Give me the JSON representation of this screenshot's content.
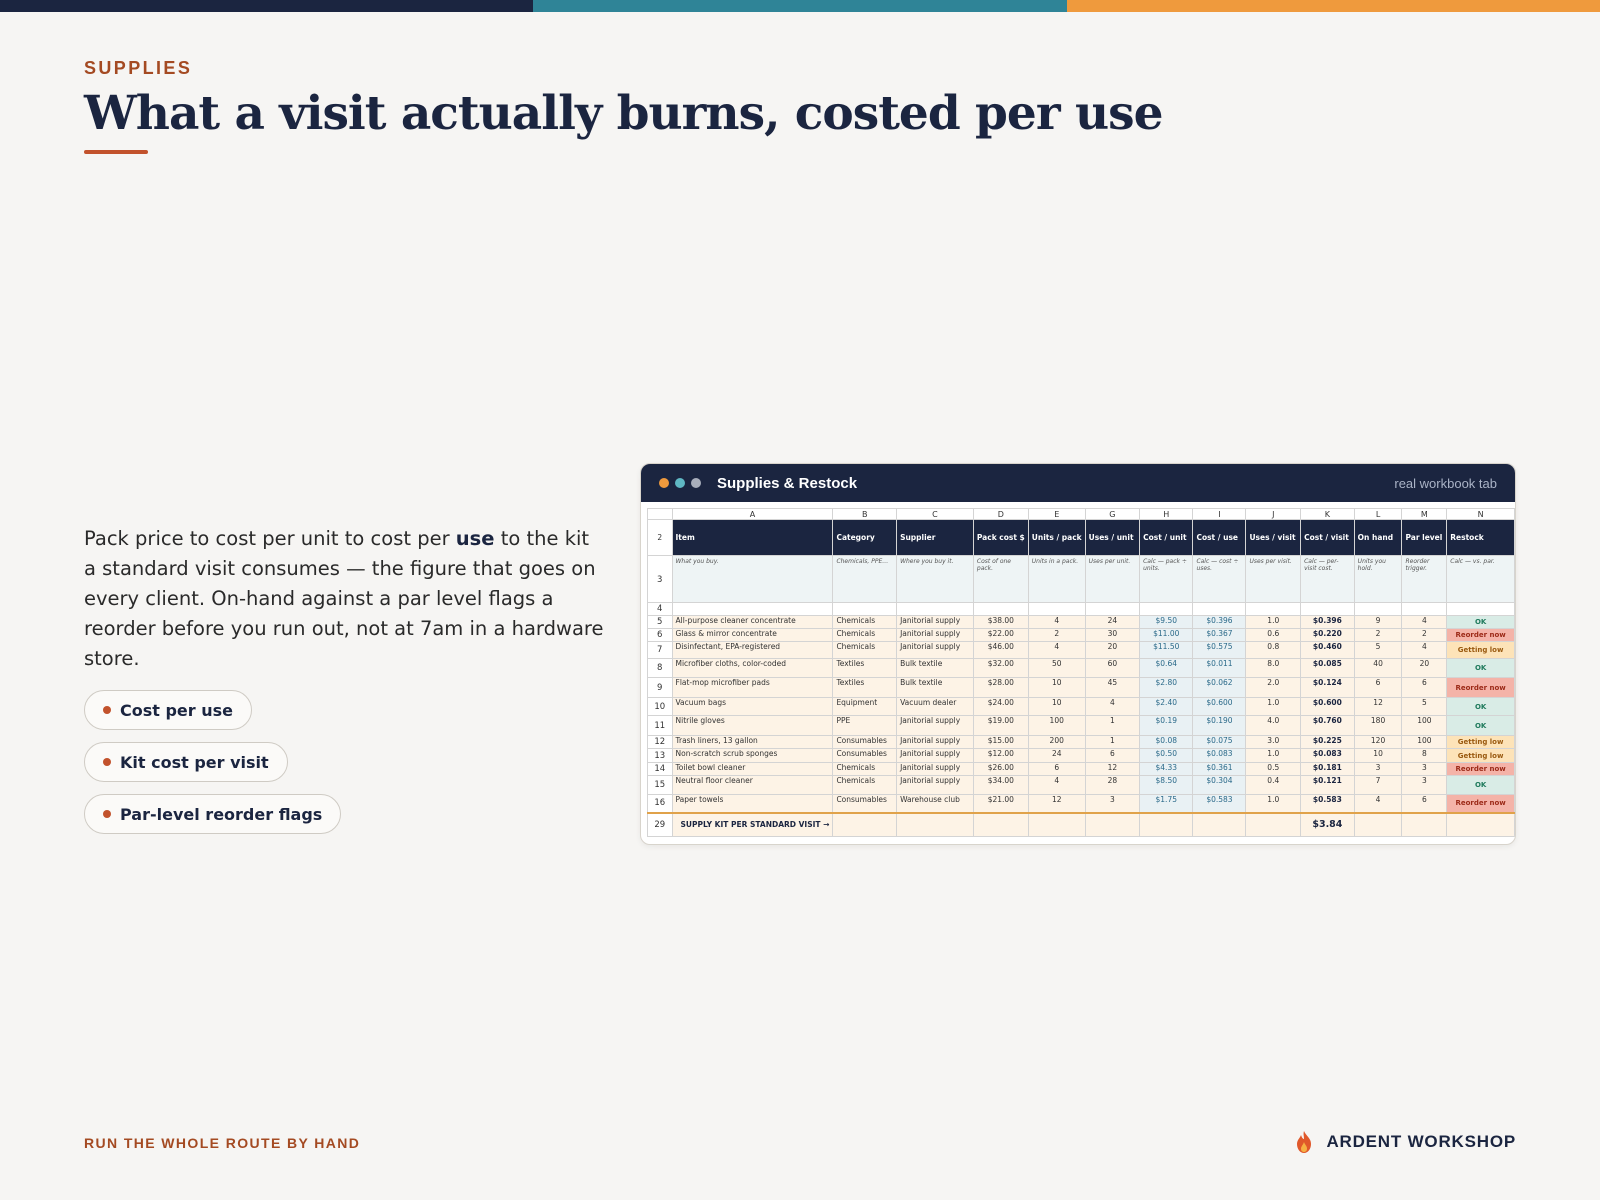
{
  "colors": {
    "navy": "#1b2540",
    "teal": "#2f8497",
    "orange": "#ef9a3d",
    "rust": "#c2522c"
  },
  "header": {
    "eyebrow": "SUPPLIES",
    "title": "What a visit actually burns, costed per use"
  },
  "body": {
    "part1": "Pack price to cost per unit to cost per ",
    "bold": "use",
    "part2": " to the kit a standard visit consumes — the figure that goes on every client. On-hand against a par level flags a reorder before you run out, not at 7am in a hardware store."
  },
  "chips": [
    "Cost per use",
    "Kit cost per visit",
    "Par-level reorder flags"
  ],
  "window": {
    "title": "Supplies & Restock",
    "note": "real workbook tab",
    "columns": [
      "A",
      "B",
      "C",
      "D",
      "E",
      "G",
      "H",
      "I",
      "J",
      "K",
      "L",
      "M",
      "N"
    ],
    "header_row_num": "2",
    "headers": [
      "Item",
      "Category",
      "Supplier",
      "Pack cost $",
      "Units / pack",
      "Uses / unit",
      "Cost / unit",
      "Cost / use",
      "Uses / visit",
      "Cost / visit",
      "On hand",
      "Par level",
      "Restock"
    ],
    "desc_row_num": "3",
    "descriptions": [
      "What you buy.",
      "Chemicals, PPE…",
      "Where you buy it.",
      "Cost of one pack.",
      "Units in a pack.",
      "Uses per unit.",
      "Calc — pack ÷ units.",
      "Calc — cost ÷ uses.",
      "Uses per visit.",
      "Calc — per-visit cost.",
      "Units you hold.",
      "Reorder trigger.",
      "Calc — vs. par."
    ],
    "blank_row_num": "4",
    "rows": [
      {
        "n": "5",
        "cells": [
          "All-purpose cleaner concentrate",
          "Chemicals",
          "Janitorial supply",
          "$38.00",
          "4",
          "24",
          "$9.50",
          "$0.396",
          "1.0",
          "$0.396",
          "9",
          "4",
          "OK"
        ],
        "status": "ok",
        "h": 13
      },
      {
        "n": "6",
        "cells": [
          "Glass & mirror concentrate",
          "Chemicals",
          "Janitorial supply",
          "$22.00",
          "2",
          "30",
          "$11.00",
          "$0.367",
          "0.6",
          "$0.220",
          "2",
          "2",
          "Reorder now"
        ],
        "status": "re",
        "h": 13
      },
      {
        "n": "7",
        "cells": [
          "Disinfectant, EPA-registered",
          "Chemicals",
          "Janitorial supply",
          "$46.00",
          "4",
          "20",
          "$11.50",
          "$0.575",
          "0.8",
          "$0.460",
          "5",
          "4",
          "Getting low"
        ],
        "status": "gl",
        "h": 17
      },
      {
        "n": "8",
        "cells": [
          "Microfiber cloths, color-coded",
          "Textiles",
          "Bulk textile",
          "$32.00",
          "50",
          "60",
          "$0.64",
          "$0.011",
          "8.0",
          "$0.085",
          "40",
          "20",
          "OK"
        ],
        "status": "ok",
        "h": 19
      },
      {
        "n": "9",
        "cells": [
          "Flat-mop microfiber pads",
          "Textiles",
          "Bulk textile",
          "$28.00",
          "10",
          "45",
          "$2.80",
          "$0.062",
          "2.0",
          "$0.124",
          "6",
          "6",
          "Reorder now"
        ],
        "status": "re",
        "h": 20
      },
      {
        "n": "10",
        "cells": [
          "Vacuum bags",
          "Equipment",
          "Vacuum dealer",
          "$24.00",
          "10",
          "4",
          "$2.40",
          "$0.600",
          "1.0",
          "$0.600",
          "12",
          "5",
          "OK"
        ],
        "status": "ok",
        "h": 18
      },
      {
        "n": "11",
        "cells": [
          "Nitrile gloves",
          "PPE",
          "Janitorial supply",
          "$19.00",
          "100",
          "1",
          "$0.19",
          "$0.190",
          "4.0",
          "$0.760",
          "180",
          "100",
          "OK"
        ],
        "status": "ok",
        "h": 20
      },
      {
        "n": "12",
        "cells": [
          "Trash liners, 13 gallon",
          "Consumables",
          "Janitorial supply",
          "$15.00",
          "200",
          "1",
          "$0.08",
          "$0.075",
          "3.0",
          "$0.225",
          "120",
          "100",
          "Getting low"
        ],
        "status": "gl",
        "h": 13
      },
      {
        "n": "13",
        "cells": [
          "Non-scratch scrub sponges",
          "Consumables",
          "Janitorial supply",
          "$12.00",
          "24",
          "6",
          "$0.50",
          "$0.083",
          "1.0",
          "$0.083",
          "10",
          "8",
          "Getting low"
        ],
        "status": "gl",
        "h": 14
      },
      {
        "n": "14",
        "cells": [
          "Toilet bowl cleaner",
          "Chemicals",
          "Janitorial supply",
          "$26.00",
          "6",
          "12",
          "$4.33",
          "$0.361",
          "0.5",
          "$0.181",
          "3",
          "3",
          "Reorder now"
        ],
        "status": "re",
        "h": 13
      },
      {
        "n": "15",
        "cells": [
          "Neutral floor cleaner",
          "Chemicals",
          "Janitorial supply",
          "$34.00",
          "4",
          "28",
          "$8.50",
          "$0.304",
          "0.4",
          "$0.121",
          "7",
          "3",
          "OK"
        ],
        "status": "ok",
        "h": 19
      },
      {
        "n": "16",
        "cells": [
          "Paper towels",
          "Consumables",
          "Warehouse club",
          "$21.00",
          "12",
          "3",
          "$1.75",
          "$0.583",
          "1.0",
          "$0.583",
          "4",
          "6",
          "Reorder now"
        ],
        "status": "re",
        "h": 18
      }
    ],
    "total": {
      "n": "29",
      "label": "SUPPLY KIT PER STANDARD VISIT →",
      "value": "$3.84"
    }
  },
  "footer": {
    "left": "RUN THE WHOLE ROUTE BY HAND",
    "brand": "ARDENT WORKSHOP",
    "brand_icon": "flame-icon"
  }
}
